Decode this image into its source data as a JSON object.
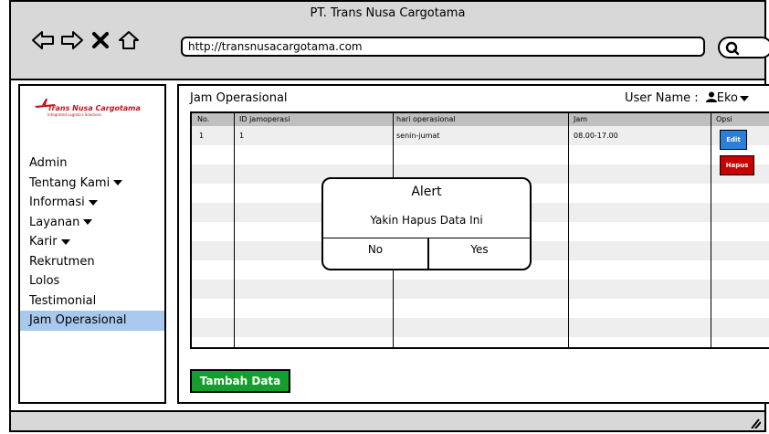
{
  "window": {
    "title": "PT. Trans Nusa Cargotama",
    "url": "http://transnusacargotama.com"
  },
  "nav": {
    "back_icon": "back-arrow-icon",
    "forward_icon": "forward-arrow-icon",
    "close_icon": "close-icon",
    "home_icon": "home-icon",
    "search_icon": "search-icon"
  },
  "logo": {
    "name": "Trans Nusa Cargotama",
    "tagline": "Integrated Logistics Solutions"
  },
  "sidebar": {
    "items": [
      {
        "label": "Admin",
        "dropdown": false
      },
      {
        "label": "Tentang Kami",
        "dropdown": true
      },
      {
        "label": "Informasi",
        "dropdown": true
      },
      {
        "label": "Layanan",
        "dropdown": true
      },
      {
        "label": "Karir",
        "dropdown": true
      },
      {
        "label": "Rekrutmen",
        "dropdown": false
      },
      {
        "label": "Lolos",
        "dropdown": false
      },
      {
        "label": "Testimonial",
        "dropdown": false
      },
      {
        "label": "Jam Operasional",
        "dropdown": false,
        "active": true
      }
    ]
  },
  "main": {
    "title": "Jam Operasional",
    "user_label": "User Name :",
    "user_name": "Eko",
    "table": {
      "headers": [
        "No.",
        "ID jamoperasi",
        "hari operasional",
        "Jam",
        "Opsi"
      ],
      "rows": [
        {
          "no": "1",
          "id": "1",
          "hari": "senin-jumat",
          "jam": "08.00-17.00"
        }
      ],
      "edit_label": "Edit",
      "hapus_label": "Hapus"
    },
    "add_button": "Tambah Data"
  },
  "alert": {
    "title": "Alert",
    "message": "Yakin Hapus Data Ini",
    "no": "No",
    "yes": "Yes"
  },
  "colors": {
    "accent_blue": "#2a7fd9",
    "danger_red": "#c80000",
    "success_green": "#12a02a",
    "active_item": "#a8c8ee",
    "logo_red": "#c0151c"
  }
}
